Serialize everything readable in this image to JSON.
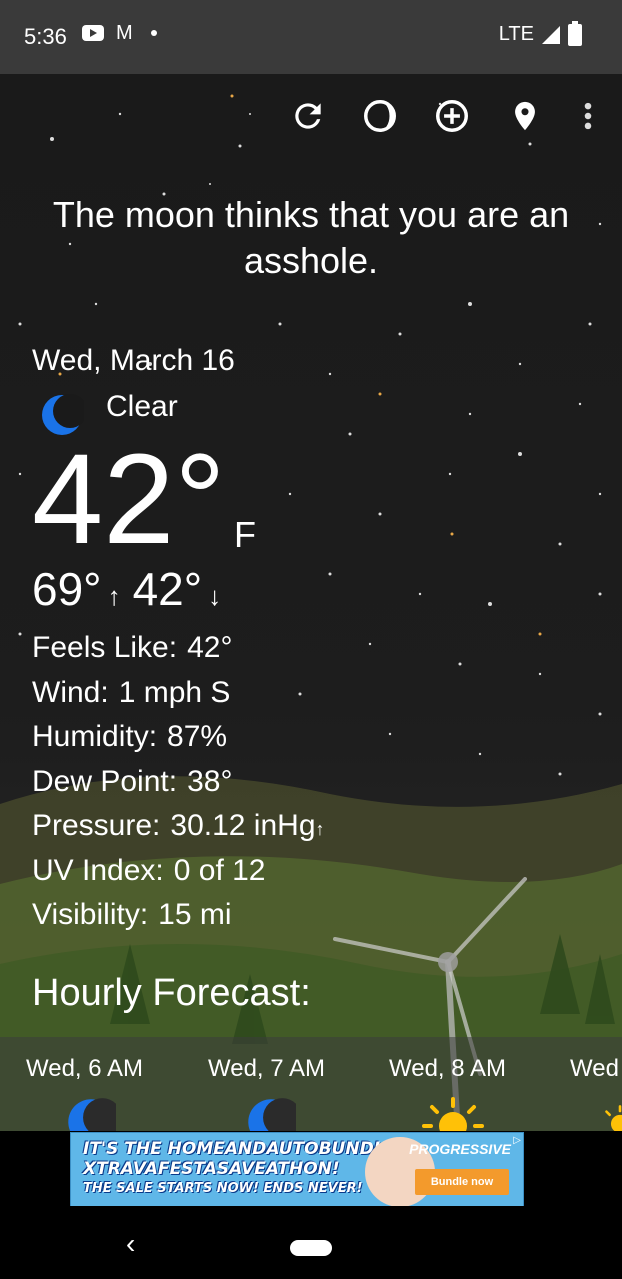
{
  "status_bar": {
    "time": "5:36",
    "network": "LTE"
  },
  "toolbar": {
    "icons": [
      "refresh-icon",
      "moon-phase-icon",
      "add-icon",
      "location-pin-icon",
      "more-vert-icon"
    ]
  },
  "headline": "The moon thinks that you are an asshole.",
  "current": {
    "date": "Wed, March 16",
    "condition": "Clear",
    "condition_icon": "crescent-moon-icon",
    "temperature": "42°",
    "unit": "F",
    "high": "69°",
    "high_arrow": "↑",
    "low": "42°",
    "low_arrow": "↓"
  },
  "details": [
    {
      "label": "Feels Like:",
      "value": "42°"
    },
    {
      "label": "Wind:",
      "value": "1 mph S"
    },
    {
      "label": "Humidity:",
      "value": "87%"
    },
    {
      "label": "Dew Point:",
      "value": "38°"
    },
    {
      "label": "Pressure:",
      "value": "30.12 inHg",
      "trend": "↑"
    },
    {
      "label": "UV Index:",
      "value": "0 of 12"
    },
    {
      "label": "Visibility:",
      "value": "15 mi"
    }
  ],
  "hourly": {
    "title": "Hourly Forecast:",
    "items": [
      {
        "time": "Wed, 6 AM",
        "icon": "crescent-moon-icon"
      },
      {
        "time": "Wed, 7 AM",
        "icon": "crescent-moon-icon"
      },
      {
        "time": "Wed, 8 AM",
        "icon": "sun-icon"
      },
      {
        "time": "Wed",
        "icon": "sun-icon"
      }
    ]
  },
  "ad": {
    "line1": "IT'S THE HOMEANDAUTOBUNDLE",
    "line2": "XTRAVAFESTASAVEATHON!",
    "line3": "THE SALE STARTS NOW! ENDS NEVER!",
    "brand": "PROGRESSIVE",
    "cta": "Bundle now"
  },
  "colors": {
    "sky": "#1a1a1a",
    "moon_blue": "#1a73e8",
    "sun_yellow": "#ffc107",
    "ad_bg": "#5fb7e8",
    "ad_button": "#f39a2c"
  }
}
